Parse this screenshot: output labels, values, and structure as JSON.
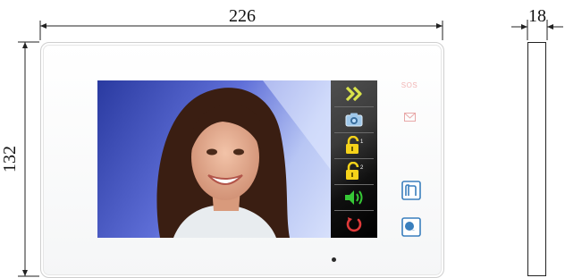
{
  "dimensions": {
    "width_label": "226",
    "height_label": "132",
    "depth_label": "18"
  },
  "device": {
    "front_labels": {
      "sos": "SOS"
    },
    "menu_icons": [
      "double-chevron-right-icon",
      "camera-icon",
      "unlock-1-icon",
      "unlock-2-icon",
      "speaker-volume-icon",
      "power-icon"
    ],
    "front_icons": [
      "envelope-icon",
      "door-icon",
      "intercom-icon"
    ],
    "colors": {
      "menu_chevron": "#d9e34b",
      "lock": "#f5d21a",
      "speaker": "#36c836",
      "power": "#e03a3a",
      "front_button": "#3a7fbd"
    }
  }
}
